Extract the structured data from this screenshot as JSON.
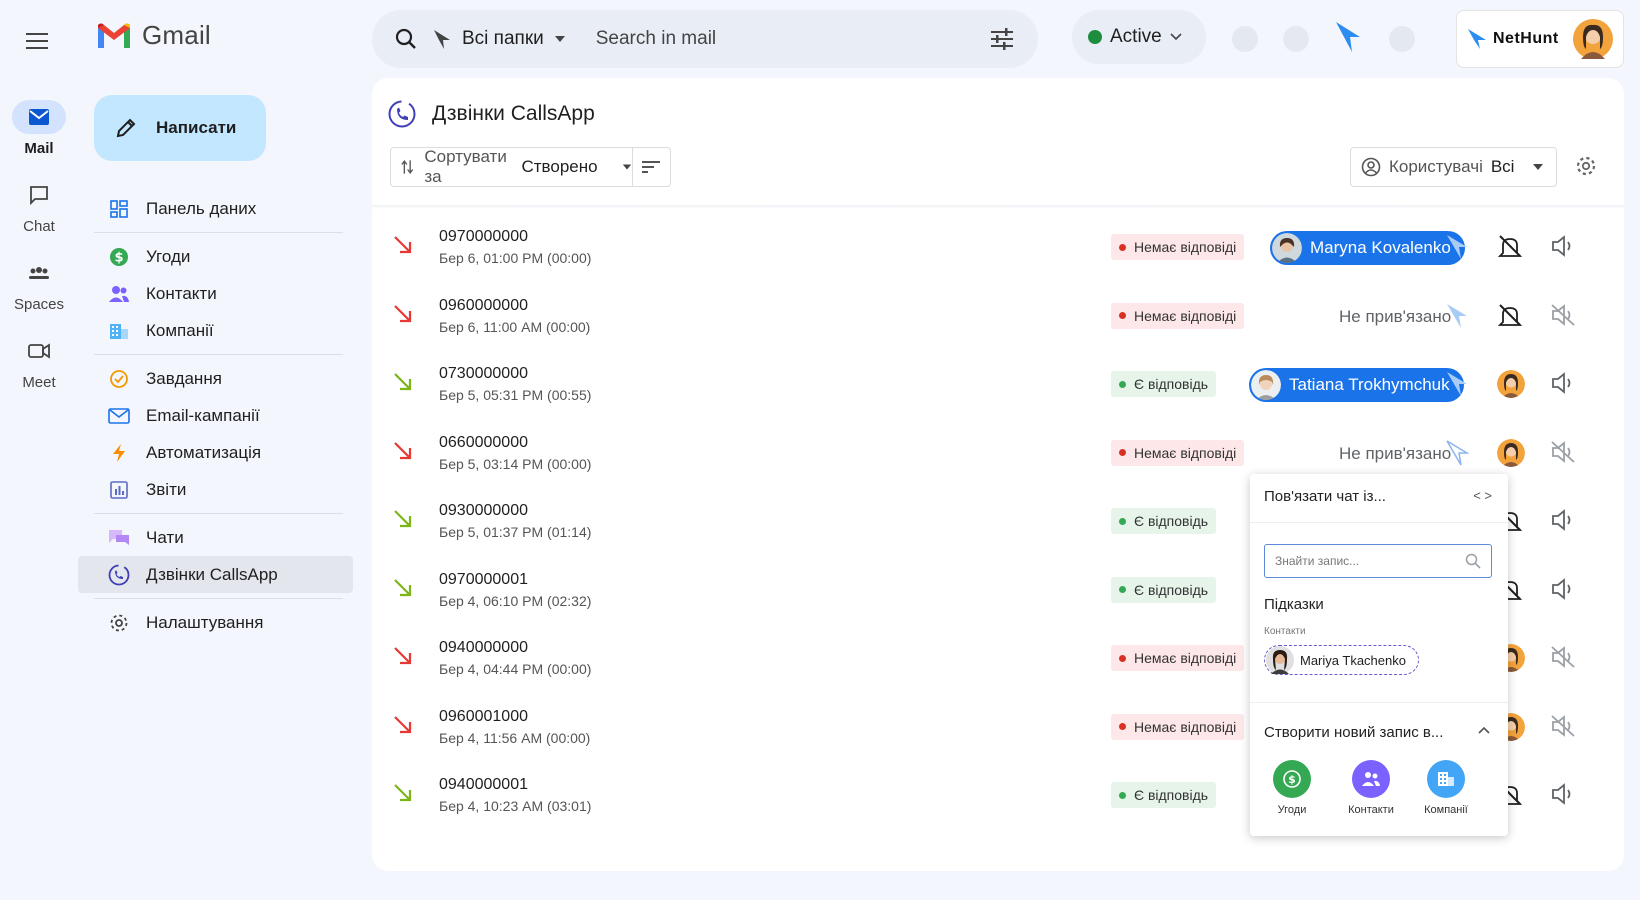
{
  "app": {
    "title": "Gmail"
  },
  "rail": [
    {
      "id": "mail",
      "label": "Mail",
      "icon": "mail-icon",
      "active": true
    },
    {
      "id": "chat",
      "label": "Chat",
      "icon": "chat-icon",
      "active": false
    },
    {
      "id": "spaces",
      "label": "Spaces",
      "icon": "spaces-icon",
      "active": false
    },
    {
      "id": "meet",
      "label": "Meet",
      "icon": "meet-icon",
      "active": false
    }
  ],
  "compose": {
    "label": "Написати"
  },
  "nav": {
    "dashboard": "Панель даних",
    "deals": "Угоди",
    "contacts": "Контакти",
    "companies": "Компанії",
    "tasks": "Завдання",
    "email_campaigns": "Email-кампанії",
    "automation": "Автоматизація",
    "reports": "Звіти",
    "chats": "Чати",
    "calls": "Дзвінки CallsApp",
    "settings": "Налаштування"
  },
  "search": {
    "folder": "Всі папки",
    "placeholder": "Search in mail"
  },
  "status": {
    "label": "Active",
    "color": "#1e8e3e"
  },
  "nethunt": {
    "brand": "NetHunt"
  },
  "calls": {
    "title": "Дзвінки CallsApp",
    "sort_prefix": "Сортувати за",
    "sort_value": "Створено",
    "user_filter_prefix": "Користувачі",
    "user_filter_value": "Всі",
    "unlinked_label": "Не прив'язано",
    "rows": [
      {
        "number": "0970000000",
        "meta": "Бер 6, 01:00 PM (00:00)",
        "direction": "missed",
        "status": "Немає відповіді",
        "answered": false,
        "linked": "Maryna Kovalenko"
      },
      {
        "number": "0960000000",
        "meta": "Бер 6, 11:00 AM (00:00)",
        "direction": "missed",
        "status": "Немає відповіді",
        "answered": false,
        "linked": null
      },
      {
        "number": "0730000000",
        "meta": "Бер 5, 05:31 PM (00:55)",
        "direction": "incoming",
        "status": "Є відповідь",
        "answered": true,
        "linked": "Tatiana Trokhymchuk"
      },
      {
        "number": "0660000000",
        "meta": "Бер 5, 03:14 PM (00:00)",
        "direction": "missed",
        "status": "Немає відповіді",
        "answered": false,
        "linked": null
      },
      {
        "number": "0930000000",
        "meta": "Бер 5, 01:37 PM (01:14)",
        "direction": "incoming",
        "status": "Є відповідь",
        "answered": true,
        "linked": null
      },
      {
        "number": "0970000001",
        "meta": "Бер 4, 06:10 PM (02:32)",
        "direction": "incoming",
        "status": "Є відповідь",
        "answered": true,
        "linked": null
      },
      {
        "number": "0940000000",
        "meta": "Бер 4, 04:44 PM (00:00)",
        "direction": "missed",
        "status": "Немає відповіді",
        "answered": false,
        "linked": null
      },
      {
        "number": "0960001000",
        "meta": "Бер 4, 11:56 AM (00:00)",
        "direction": "missed",
        "status": "Немає відповіді",
        "answered": false,
        "linked": null
      },
      {
        "number": "0940000001",
        "meta": "Бер 4, 10:23 AM (03:01)",
        "direction": "incoming",
        "status": "Є відповідь",
        "answered": true,
        "linked": null
      }
    ]
  },
  "popup": {
    "title": "Пов'язати чат із...",
    "search_placeholder": "Знайти запис...",
    "hints_title": "Підказки",
    "hints_category": "Контакти",
    "suggested_contact": "Mariya Tkachenko",
    "create_title": "Створити новий запис в...",
    "create_deals": "Угоди",
    "create_contacts": "Контакти",
    "create_companies": "Компанії"
  },
  "colors": {
    "accent": "#1a73e8",
    "missed": "#e53935",
    "answered": "#7cb518",
    "nethunt_blue": "#2d8cf0"
  }
}
